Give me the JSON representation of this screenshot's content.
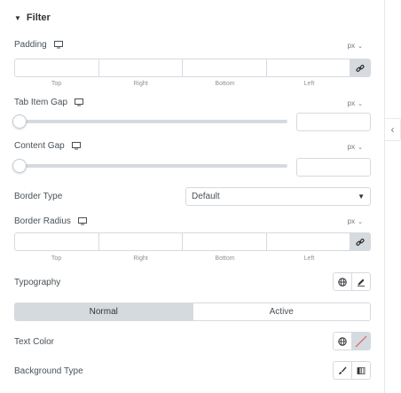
{
  "section": {
    "title": "Filter"
  },
  "padding": {
    "label": "Padding",
    "unit": "px",
    "fields": [
      "Top",
      "Right",
      "Bottom",
      "Left"
    ]
  },
  "tab_item_gap": {
    "label": "Tab Item Gap",
    "unit": "px",
    "value": ""
  },
  "content_gap": {
    "label": "Content Gap",
    "unit": "px",
    "value": ""
  },
  "border_type": {
    "label": "Border Type",
    "value": "Default"
  },
  "border_radius": {
    "label": "Border Radius",
    "unit": "px",
    "fields": [
      "Top",
      "Right",
      "Bottom",
      "Left"
    ]
  },
  "typography": {
    "label": "Typography"
  },
  "state_tabs": {
    "normal": "Normal",
    "active": "Active",
    "selected": "Normal"
  },
  "text_color": {
    "label": "Text Color"
  },
  "background_type": {
    "label": "Background Type"
  },
  "colors": {
    "accent": "#d5dadf",
    "text": "#495157",
    "slash": "#d9534f"
  },
  "icons": [
    "monitor-icon",
    "link-icon",
    "globe-icon",
    "pencil-icon",
    "brush-icon",
    "gradient-icon",
    "chevron-left-icon"
  ]
}
